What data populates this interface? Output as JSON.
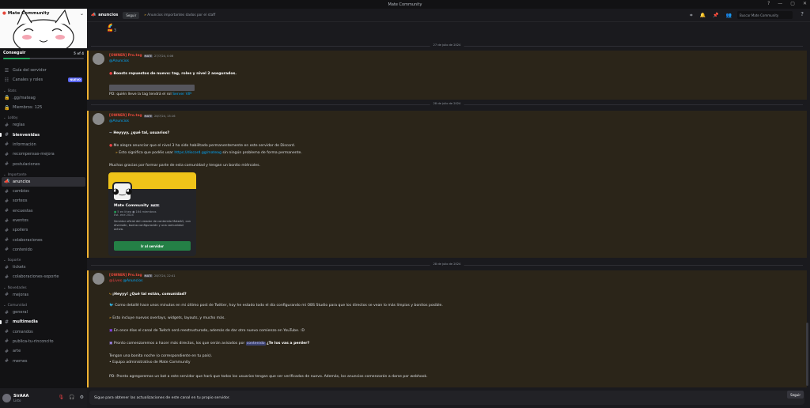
{
  "window": {
    "title": "Mate Community"
  },
  "server": {
    "name": "Mate Community",
    "boost_goal": "Conseguir",
    "boost_count": "5 of 4"
  },
  "sidebar": {
    "top": [
      {
        "icon": "book",
        "label": "Guía del servidor"
      },
      {
        "icon": "roles",
        "label": "Canales y roles",
        "badge": "NUEVO"
      }
    ],
    "categories": [
      {
        "name": "Stats",
        "items": [
          {
            "icon": "lock",
            "label": ".gg/mateag"
          },
          {
            "icon": "lock",
            "label": "Miembros: 125"
          }
        ]
      },
      {
        "name": "Lobby",
        "items": [
          {
            "icon": "hash",
            "label": "reglas"
          },
          {
            "icon": "hash",
            "label": "bienvenidas",
            "bold": true
          },
          {
            "icon": "hash",
            "label": "información"
          },
          {
            "icon": "hash",
            "label": "recompensas-mejora"
          },
          {
            "icon": "hash",
            "label": "postulaciones"
          }
        ]
      },
      {
        "name": "Importante",
        "items": [
          {
            "icon": "megaphone",
            "label": "anuncios",
            "selected": true
          },
          {
            "icon": "hash",
            "label": "cambios"
          },
          {
            "icon": "hash",
            "label": "sorteos"
          },
          {
            "icon": "hash",
            "label": "encuestas"
          },
          {
            "icon": "hash",
            "label": "eventos"
          },
          {
            "icon": "hash",
            "label": "spoilers"
          },
          {
            "icon": "hash",
            "label": "colaboraciones"
          },
          {
            "icon": "hash",
            "label": "contenido"
          }
        ]
      },
      {
        "name": "Soporte",
        "items": [
          {
            "icon": "hash",
            "label": "tickets"
          },
          {
            "icon": "hash",
            "label": "colaboraciones-soporte"
          }
        ]
      },
      {
        "name": "Novedades",
        "items": [
          {
            "icon": "hash",
            "label": "mejoras"
          }
        ]
      },
      {
        "name": "Comunidad",
        "items": [
          {
            "icon": "hash",
            "label": "general"
          },
          {
            "icon": "hash",
            "label": "multimedia",
            "bold": true
          },
          {
            "icon": "hash",
            "label": "comandos"
          },
          {
            "icon": "hash",
            "label": "publica-tu-rinconcito"
          },
          {
            "icon": "hash",
            "label": "arte"
          },
          {
            "icon": "hash",
            "label": "memes"
          }
        ]
      }
    ]
  },
  "user": {
    "name": "SirAAA",
    "status": "Listo"
  },
  "topbar": {
    "channel": "anuncios",
    "follow": "Seguir",
    "topic": "Anuncios importantes dados por el staff",
    "search_placeholder": "Buscar Mate Community"
  },
  "dividers": [
    "27 de julio de 2024",
    "28 de julio de 2024",
    "28 de julio de 2024"
  ],
  "messages": [
    {
      "author": "[OWNER] Pro.tag",
      "tag": "MATE",
      "time": "27/7/24, 0:06",
      "role": "@Anuncios",
      "lines": [
        "Boosts repuestos de nuevo: tag, roles y nivel 2 asegurados.",
        "PD: quién lleve la tag tendrá el rol"
      ],
      "role_ref": "Server VIP"
    },
    {
      "author": "[OWNER] Pro.tag",
      "tag": "MATE",
      "time": "28/7/24, 15:16",
      "role": "@Anuncios",
      "lines": [
        "Heyyyy, ¿qué tal, usuarios?",
        "Me alegra anunciar que el nivel 3 ha sido habilitado permanentemente en este servidor de Discord.",
        "Esto significa que podéis usar",
        "sin ningún problema de forma permanente.",
        "Muchas gracias por formar parte de esta comunidad y tengan un bonito miércoles."
      ],
      "link": "https://discord.gg/mateag"
    },
    {
      "author": "[OWNER] Pro.tag",
      "tag": "MATE",
      "time": "28/7/24, 22:41",
      "roles": [
        "@Lives",
        "@Anuncios"
      ],
      "lines": [
        "¡Heyyy! ¿Qué tal están, comunidad?",
        "Como detallé hace unos minutos en mi último post de Twitter, hoy he estado todo el día configurando mi OBS Studio para que los directos se vean lo más limpios y bonitos posible.",
        "Esto incluye nuevos overlays, widgets, layouts, y mucho más.",
        "En once días el canal de Twitch será reestructurado, además de dar otro nuevo comienzo en YouTube. :D",
        "Pronto comenzaremos a hacer más directos, los que serán avisados por",
        "contenido",
        "¿Te los vas a perder?",
        "Tengan una bonita noche (o correspondiente en tu país).",
        "Equipo administrativo de Mate Community",
        "PD: Pronto agregaremos un bot a este servidor que hará que todos los usuarios tengan que ser verificados de nuevo. Además, los anuncios comenzarán a darse por webhook."
      ]
    }
  ],
  "invite_card": {
    "name": "Mate Community",
    "tag": "MATE",
    "online": "5 en línea",
    "members": "164 miembros",
    "since": "Est. ene 2024",
    "desc": "Servidor oficial del creador de contenido MateAG, con diversión, buena configuración y una comunidad activa.",
    "button": "Ir al servidor"
  },
  "input": {
    "text": "Sigue para obtener las actualizaciones de este canal en tu propio servidor.",
    "button": "Seguir"
  },
  "colors": {
    "accent": "#f0b232",
    "highlight_bg": "#2b2519",
    "owner": "#e7483b",
    "link": "#00a8fc",
    "join": "#248046"
  }
}
